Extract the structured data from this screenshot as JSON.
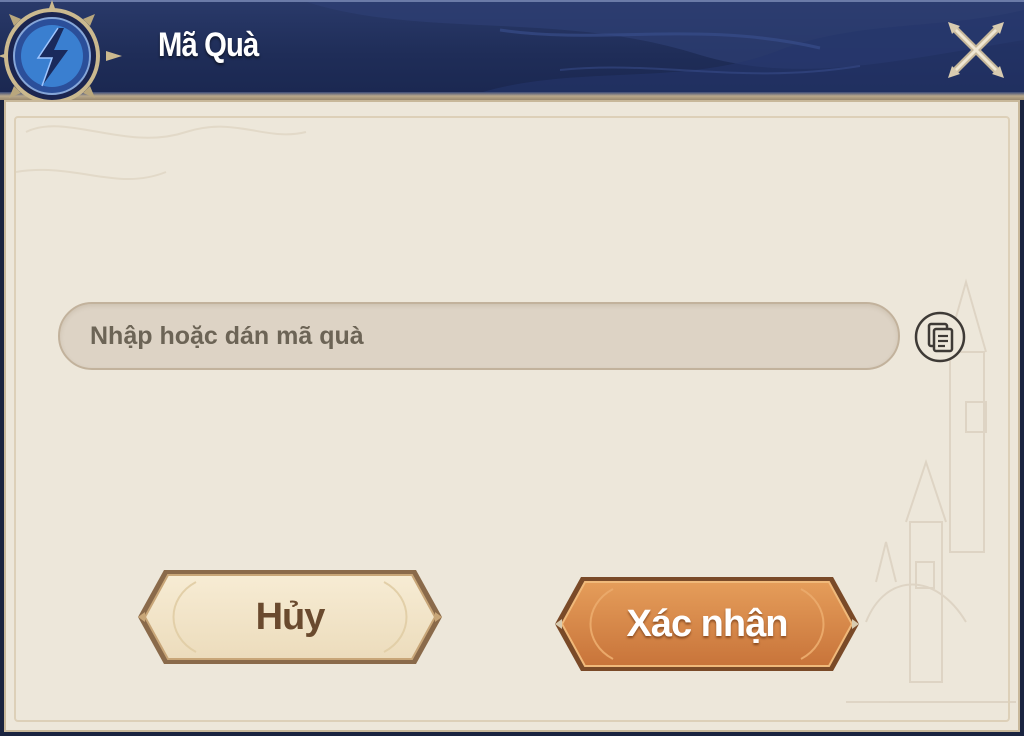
{
  "dialog": {
    "title": "Mã Quà"
  },
  "gift_code": {
    "value": "",
    "placeholder": "Nhập hoặc dán mã quà"
  },
  "buttons": {
    "cancel_label": "Hủy",
    "confirm_label": "Xác nhận"
  },
  "icons": {
    "emblem": "lightning-emblem-icon",
    "close": "close-icon",
    "paste": "paste-clipboard-icon"
  },
  "colors": {
    "header_bg": "#1f2d58",
    "panel_bg": "#ede7da",
    "cancel_button": "#f1e4c8",
    "confirm_button": "#d98c4c",
    "accent_blue": "#3a7fd0"
  }
}
